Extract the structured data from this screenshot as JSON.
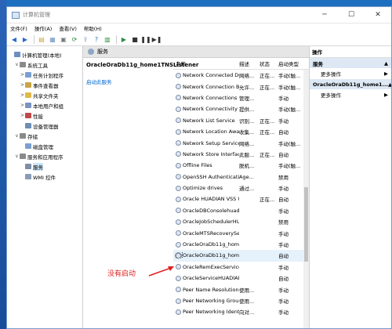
{
  "window": {
    "title": "计算机管理"
  },
  "menu": [
    "文件(F)",
    "操作(A)",
    "查看(V)",
    "帮助(H)"
  ],
  "toolbar_icons": [
    "back-icon",
    "forward-icon",
    "up-folder-icon",
    "show-tree-icon",
    "properties-icon",
    "refresh-icon",
    "export-icon",
    "help-icon",
    "play-icon",
    "stop-icon",
    "pause-icon",
    "restart-icon"
  ],
  "tree": [
    {
      "label": "计算机管理(本地)",
      "level": 0,
      "arrow": "",
      "color": "#6c8fbf"
    },
    {
      "label": "系统工具",
      "level": 1,
      "arrow": "∨",
      "color": "#8a8a8a"
    },
    {
      "label": "任务计划程序",
      "level": 2,
      "arrow": ">",
      "color": "#7aa0d0"
    },
    {
      "label": "事件查看器",
      "level": 2,
      "arrow": ">",
      "color": "#c9a445"
    },
    {
      "label": "共享文件夹",
      "level": 2,
      "arrow": ">",
      "color": "#e0b84a"
    },
    {
      "label": "本地用户和组",
      "level": 2,
      "arrow": ">",
      "color": "#7b93c1"
    },
    {
      "label": "性能",
      "level": 2,
      "arrow": ">",
      "color": "#c04848"
    },
    {
      "label": "设备管理器",
      "level": 2,
      "arrow": "",
      "color": "#6d8eb5"
    },
    {
      "label": "存储",
      "level": 1,
      "arrow": "∨",
      "color": "#8a8a8a"
    },
    {
      "label": "磁盘管理",
      "level": 2,
      "arrow": "",
      "color": "#7aa0d0"
    },
    {
      "label": "服务和应用程序",
      "level": 1,
      "arrow": "∨",
      "color": "#8a8a8a"
    },
    {
      "label": "服务",
      "level": 2,
      "arrow": "",
      "color": "#7d8ea6",
      "selected": true
    },
    {
      "label": "WMI 控件",
      "level": 2,
      "arrow": "",
      "color": "#8a9bb5"
    }
  ],
  "center": {
    "header": "服务",
    "selected_service": "OracleOraDb11g_home1TNSListener",
    "start_link": "启动此服务",
    "columns": {
      "name": "名称",
      "desc": "描述",
      "status": "状态",
      "type": "启动类型"
    },
    "rows": [
      {
        "name": "Network Connected Devi...",
        "desc": "网络...",
        "status": "正在...",
        "type": "手动(触..."
      },
      {
        "name": "Network Connection Bro...",
        "desc": "允许...",
        "status": "正在...",
        "type": "手动(触..."
      },
      {
        "name": "Network Connections",
        "desc": "管理...",
        "status": "",
        "type": "手动"
      },
      {
        "name": "Network Connectivity Ass...",
        "desc": "提供...",
        "status": "",
        "type": "手动(触..."
      },
      {
        "name": "Network List Service",
        "desc": "识别...",
        "status": "正在...",
        "type": "手动"
      },
      {
        "name": "Network Location Aware...",
        "desc": "收集...",
        "status": "正在...",
        "type": "自动"
      },
      {
        "name": "Network Setup Service",
        "desc": "网络...",
        "status": "",
        "type": "手动(触..."
      },
      {
        "name": "Network Store Interface ...",
        "desc": "此服...",
        "status": "正在...",
        "type": "自动"
      },
      {
        "name": "Offline Files",
        "desc": "脱机...",
        "status": "",
        "type": "手动(触..."
      },
      {
        "name": "OpenSSH Authentication ...",
        "desc": "Age...",
        "status": "",
        "type": "禁用"
      },
      {
        "name": "Optimize drives",
        "desc": "通过...",
        "status": "",
        "type": "手动"
      },
      {
        "name": "Oracle HUADIAN VSS Wr...",
        "desc": "",
        "status": "正在...",
        "type": "自动"
      },
      {
        "name": "OracleDBConsolehuadian",
        "desc": "",
        "status": "",
        "type": "手动"
      },
      {
        "name": "OracleJobSchedulerHUA...",
        "desc": "",
        "status": "",
        "type": "禁用"
      },
      {
        "name": "OracleMTSRecoveryServi...",
        "desc": "",
        "status": "",
        "type": "手动"
      },
      {
        "name": "OracleOraDb11g_home1...",
        "desc": "",
        "status": "",
        "type": "手动"
      },
      {
        "name": "OracleOraDb11g_home1...",
        "desc": "",
        "status": "",
        "type": "自动",
        "selected": true
      },
      {
        "name": "OracleRemExecService",
        "desc": "",
        "status": "",
        "type": "手动"
      },
      {
        "name": "OracleServiceHUADIAN",
        "desc": "",
        "status": "",
        "type": "自动"
      },
      {
        "name": "Peer Name Resolution Pr...",
        "desc": "使用...",
        "status": "",
        "type": "手动"
      },
      {
        "name": "Peer Networking Groupi...",
        "desc": "使用...",
        "status": "",
        "type": "手动"
      },
      {
        "name": "Peer Networking Identity...",
        "desc": "向对...",
        "status": "",
        "type": "手动"
      }
    ]
  },
  "actions": {
    "header": "操作",
    "sections": [
      {
        "title": "服务",
        "item": "更多操作"
      },
      {
        "title": "OracleOraDb11g_home1...",
        "item": "更多操作"
      }
    ]
  },
  "annotation": {
    "text": "没有启动",
    "color": "#e02020"
  }
}
